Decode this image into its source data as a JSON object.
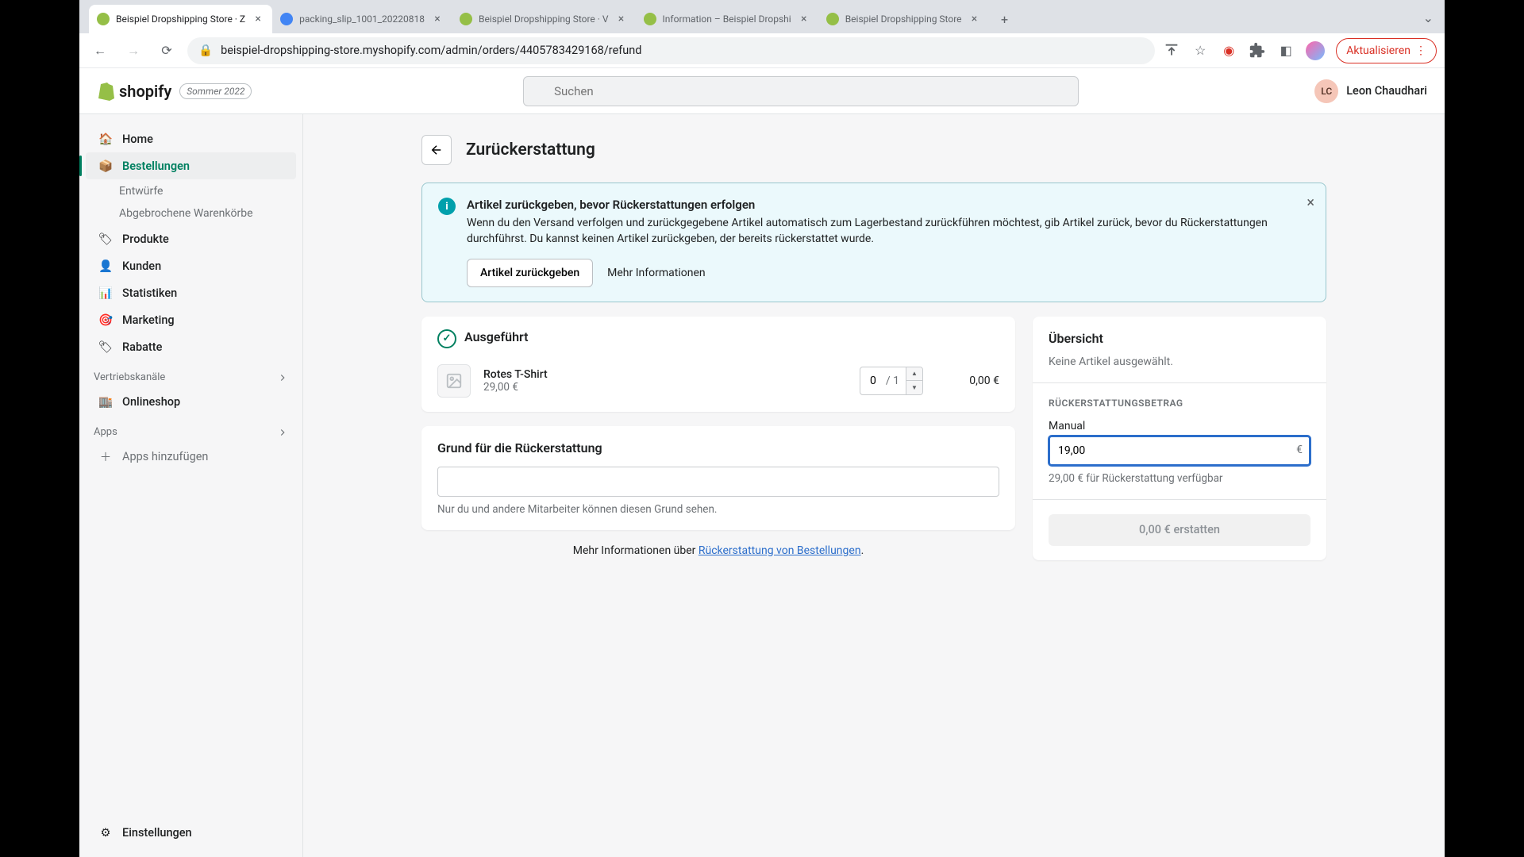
{
  "browser": {
    "tabs": [
      {
        "title": "Beispiel Dropshipping Store · Z",
        "active": true,
        "icon": "#95bf47"
      },
      {
        "title": "packing_slip_1001_20220818",
        "active": false,
        "icon": "#4285f4"
      },
      {
        "title": "Beispiel Dropshipping Store · V",
        "active": false,
        "icon": "#95bf47"
      },
      {
        "title": "Information – Beispiel Dropshi",
        "active": false,
        "icon": "#95bf47"
      },
      {
        "title": "Beispiel Dropshipping Store",
        "active": false,
        "icon": "#95bf47"
      }
    ],
    "url": "beispiel-dropshipping-store.myshopify.com/admin/orders/4405783429168/refund",
    "update_label": "Aktualisieren"
  },
  "header": {
    "brand": "shopify",
    "season_badge": "Sommer 2022",
    "search_placeholder": "Suchen",
    "user_initials": "LC",
    "user_name": "Leon Chaudhari"
  },
  "sidebar": {
    "items": [
      {
        "label": "Home",
        "icon": "home"
      },
      {
        "label": "Bestellungen",
        "icon": "orders",
        "active": true
      },
      {
        "label": "Produkte",
        "icon": "products"
      },
      {
        "label": "Kunden",
        "icon": "customers"
      },
      {
        "label": "Statistiken",
        "icon": "analytics"
      },
      {
        "label": "Marketing",
        "icon": "marketing"
      },
      {
        "label": "Rabatte",
        "icon": "discounts"
      }
    ],
    "sub_items": [
      {
        "label": "Entwürfe"
      },
      {
        "label": "Abgebrochene Warenkörbe"
      }
    ],
    "channels_label": "Vertriebskanäle",
    "onlineshop_label": "Onlineshop",
    "apps_label": "Apps",
    "add_apps_label": "Apps hinzufügen",
    "settings_label": "Einstellungen"
  },
  "page": {
    "title": "Zurückerstattung",
    "banner": {
      "title": "Artikel zurückgeben, bevor Rückerstattungen erfolgen",
      "text": "Wenn du den Versand verfolgen und zurückgegebene Artikel automatisch zum Lagerbestand zurückführen möchtest, gib Artikel zurück, bevor du Rückerstattungen durchführst. Du kannst keinen Artikel zurückgeben, der bereits rückerstattet wurde.",
      "action_primary": "Artikel zurückgeben",
      "action_secondary": "Mehr Informationen"
    },
    "fulfilled": {
      "title": "Ausgeführt",
      "item": {
        "name": "Rotes T-Shirt",
        "price": "29,00 €",
        "qty": "0",
        "of": "/ 1",
        "line_total": "0,00 €"
      }
    },
    "reason": {
      "title": "Grund für die Rückerstattung",
      "help": "Nur du und andere Mitarbeiter können diesen Grund sehen."
    },
    "more_info_prefix": "Mehr Informationen über ",
    "more_info_link": "Rückerstattung von Bestellungen",
    "more_info_suffix": ".",
    "overview": {
      "title": "Übersicht",
      "empty": "Keine Artikel ausgewählt.",
      "refund_heading": "RÜCKERSTATTUNGSBETRAG",
      "manual_label": "Manual",
      "amount_value": "19,00",
      "currency": "€",
      "available": "29,00 € für Rückerstattung verfügbar",
      "button": "0,00 € erstatten"
    }
  }
}
